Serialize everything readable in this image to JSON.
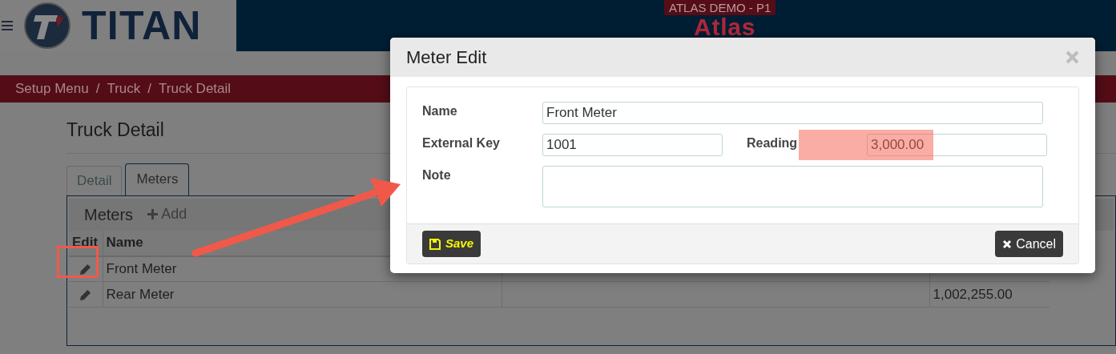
{
  "header": {
    "brand": "TITAN",
    "env_badge": "ATLAS DEMO - P1",
    "app_name": "Atlas"
  },
  "breadcrumb": {
    "separator": "/",
    "items": [
      "Setup Menu",
      "Truck",
      "Truck Detail"
    ]
  },
  "page_title": "Truck Detail",
  "tabs": [
    {
      "label": "Detail",
      "selected": false
    },
    {
      "label": "Meters",
      "selected": true
    }
  ],
  "panel": {
    "title": "Meters",
    "add_button": "Add"
  },
  "table": {
    "columns": [
      "Edit",
      "Name"
    ],
    "rows": [
      {
        "name": "Front Meter"
      },
      {
        "name": "Rear Meter",
        "column_4": "1,002,255.00"
      }
    ]
  },
  "dialog": {
    "title": "Meter Edit",
    "fields": [
      {
        "label": "Name",
        "value": "Front Meter",
        "kind": "wide"
      },
      {
        "label": "External Key",
        "value": "1001",
        "kind": "half"
      },
      {
        "label": "Reading",
        "value": "3,000.00",
        "kind": "half",
        "highlighted": true
      },
      {
        "label": "Note",
        "kind": "textarea"
      }
    ],
    "save_button": "Save",
    "cancel_button": "Cancel"
  }
}
